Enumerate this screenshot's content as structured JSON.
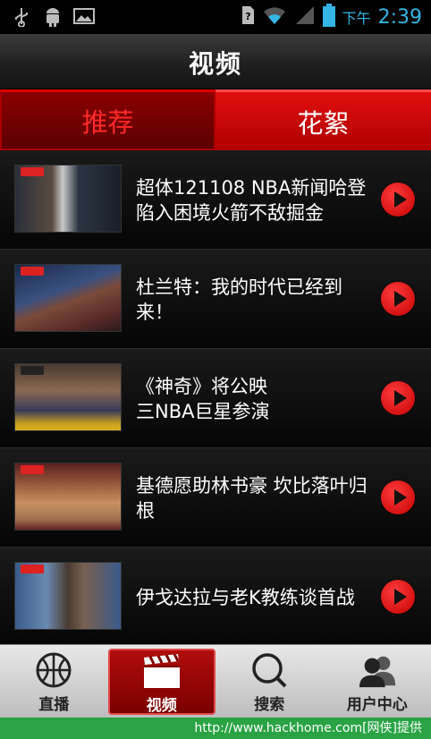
{
  "status_bar": {
    "time": "2:39",
    "ampm": "下午",
    "accent_color": "#33b5e5"
  },
  "header": {
    "title": "视频"
  },
  "tabs": [
    {
      "label": "推荐",
      "active": true
    },
    {
      "label": "花絮",
      "active": false
    }
  ],
  "videos": [
    {
      "title": "超体121108 NBA新闻哈登陷入困境火箭不敌掘金"
    },
    {
      "title": "杜兰特：我的时代已经到来！"
    },
    {
      "title": "《神奇》将公映\n三NBA巨星参演"
    },
    {
      "title": "基德愿助林书豪 坎比落叶归根"
    },
    {
      "title": "伊戈达拉与老K教练谈首战"
    }
  ],
  "bottom_nav": [
    {
      "label": "直播",
      "icon": "basketball-icon",
      "active": false
    },
    {
      "label": "视频",
      "icon": "clapperboard-icon",
      "active": true
    },
    {
      "label": "搜索",
      "icon": "search-icon",
      "active": false
    },
    {
      "label": "用户中心",
      "icon": "users-icon",
      "active": false
    }
  ],
  "footer": {
    "text": "http://www.hackhome.com[网侠]提供"
  },
  "colors": {
    "brand_red": "#d00000",
    "footer_green": "#2aa345"
  }
}
